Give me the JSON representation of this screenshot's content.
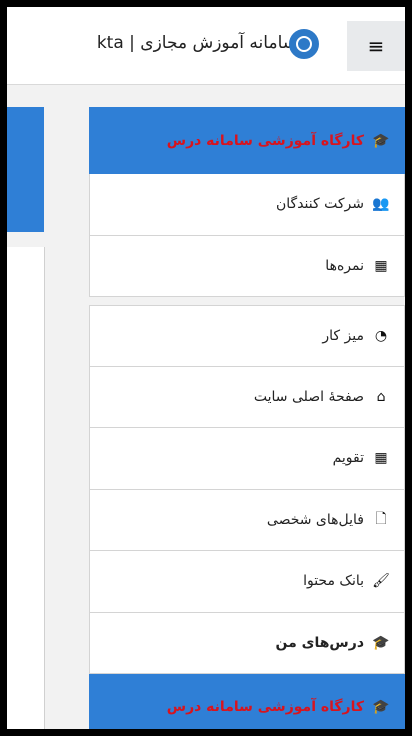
{
  "header": {
    "site_title": "kta | سامانه آموزش مجازی",
    "menu_icon": "≡"
  },
  "drawer": {
    "course_section": [
      {
        "label": "کارگاه آموزشی سامانه درس",
        "icon": "graduation-cap-icon",
        "glyph": "🎓"
      },
      {
        "label": "شرکت کنندگان",
        "icon": "users-icon",
        "glyph": "👥"
      },
      {
        "label": "نمره‌ها",
        "icon": "table-icon",
        "glyph": "▦"
      }
    ],
    "main_section": [
      {
        "label": "میز کار",
        "icon": "dashboard-icon",
        "glyph": "◔"
      },
      {
        "label": "صفحهٔ اصلی سایت",
        "icon": "home-icon",
        "glyph": "⌂"
      },
      {
        "label": "تقویم",
        "icon": "calendar-icon",
        "glyph": "▦"
      },
      {
        "label": "فایل‌های شخصی",
        "icon": "file-icon",
        "glyph": "🗋"
      },
      {
        "label": "بانک محتوا",
        "icon": "brush-icon",
        "glyph": "🖌"
      },
      {
        "label": "درس‌های من",
        "icon": "graduation-cap-icon",
        "glyph": "🎓"
      },
      {
        "label": "کارگاه آموزشی سامانه درس",
        "icon": "graduation-cap-icon",
        "glyph": "🎓"
      }
    ]
  },
  "colors": {
    "accent_blue": "#2f7fd6",
    "active_text": "#d8141e"
  }
}
